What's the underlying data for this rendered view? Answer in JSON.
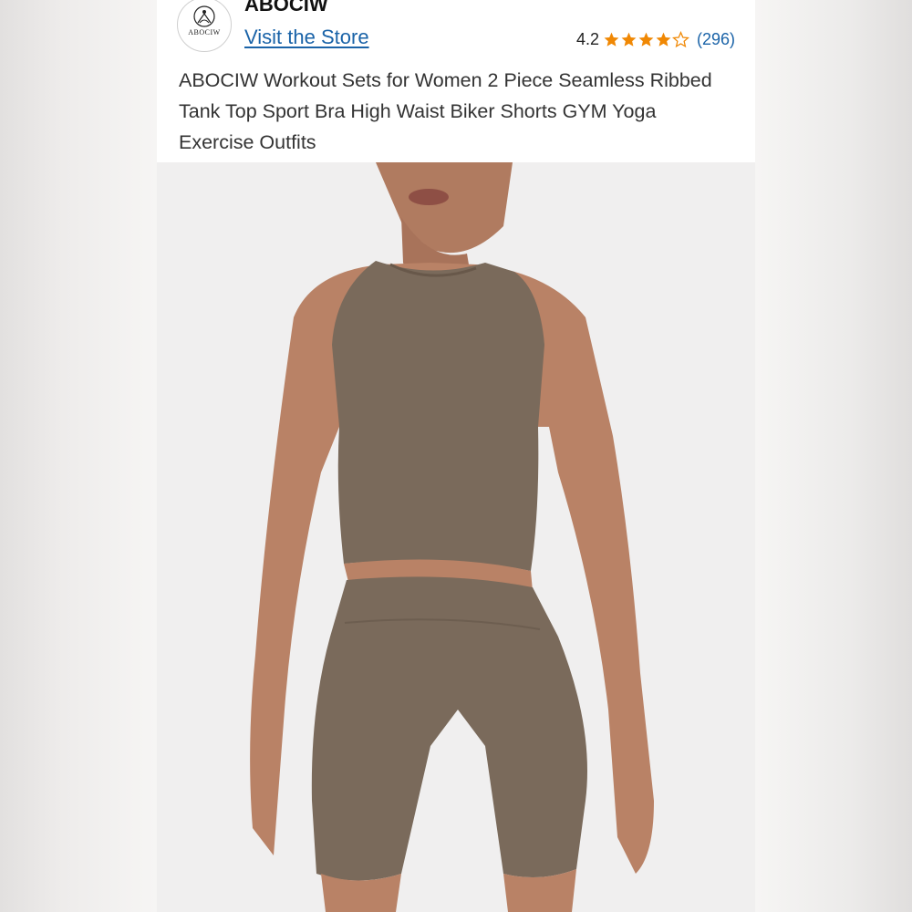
{
  "store": {
    "brand_name": "ABOCIW",
    "logo_text": "ABOCIW",
    "visit_link": "Visit the Store"
  },
  "rating": {
    "value": "4.2",
    "stars_filled": 4.2,
    "stars_max": 5,
    "review_count": "(296)",
    "star_color": "#f08804"
  },
  "product": {
    "title": "ABOCIW Workout Sets for Women 2 Piece Seamless Ribbed Tank Top Sport Bra High Waist Biker Shorts GYM Yoga Exercise Outfits",
    "image_colors": {
      "garment": "#7a6a5b",
      "skin": "#b98266",
      "background": "#f0efef"
    }
  },
  "link_color": "#1a63a8"
}
